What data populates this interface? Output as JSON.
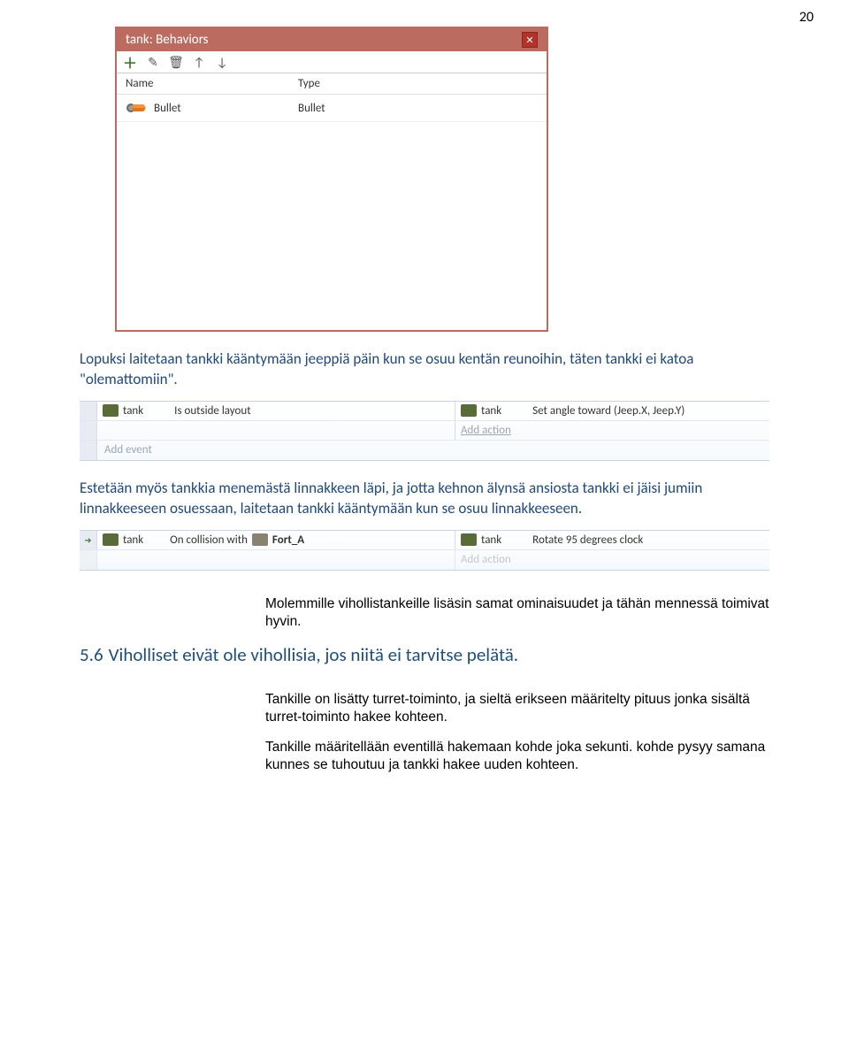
{
  "pageNumber": "20",
  "dialog": {
    "title": "tank: Behaviors",
    "col_name": "Name",
    "col_type": "Type",
    "row_name": "Bullet",
    "row_type": "Bullet"
  },
  "para1": "Lopuksi laitetaan tankki kääntymään jeeppiä päin kun se osuu kentän reunoihin, täten tankki ei katoa \"olemattomiin\".",
  "event1": {
    "cond_obj": "tank",
    "cond_text": "Is outside layout",
    "act_obj": "tank",
    "act_text": "Set angle toward (Jeep.X, Jeep.Y)",
    "add_action": "Add action",
    "add_event": "Add event"
  },
  "para2": "Estetään myös tankkia menemästä linnakkeen läpi, ja jotta kehnon älynsä ansiosta tankki ei jäisi jumiin linnakkeeseen osuessaan, laitetaan tankki kääntymään kun se osuu linnakkeeseen.",
  "event2": {
    "cond_obj": "tank",
    "cond_text_pre": "On collision with",
    "cond_target": "Fort_A",
    "act_obj": "tank",
    "act_text": "Rotate 95 degrees clock",
    "add_action": "Add action"
  },
  "para3": "Molemmille vihollistankeille lisäsin samat ominaisuudet ja tähän mennessä toimivat hyvin.",
  "heading": {
    "num": "5.6",
    "text": "Viholliset eivät ole vihollisia, jos niitä ei tarvitse pelätä."
  },
  "para4": "Tankille on lisätty turret-toiminto, ja sieltä erikseen määritelty pituus jonka sisältä turret-toiminto hakee kohteen.",
  "para5": "Tankille määritellään eventillä hakemaan kohde joka sekunti. kohde pysyy samana kunnes se tuhoutuu ja tankki hakee uuden kohteen."
}
